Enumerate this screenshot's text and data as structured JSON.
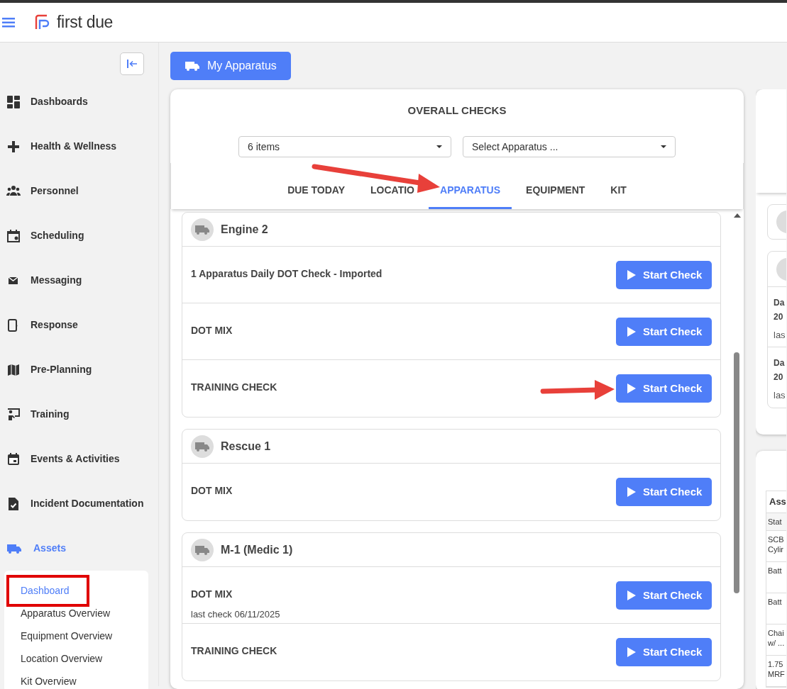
{
  "app": {
    "logo_text": "first due"
  },
  "sidebar": {
    "items": [
      {
        "label": "Dashboards",
        "selected": false
      },
      {
        "label": "Health & Wellness",
        "selected": false
      },
      {
        "label": "Personnel",
        "selected": false
      },
      {
        "label": "Scheduling",
        "selected": false
      },
      {
        "label": "Messaging",
        "selected": false
      },
      {
        "label": "Response",
        "selected": false
      },
      {
        "label": "Pre-Planning",
        "selected": false
      },
      {
        "label": "Training",
        "selected": false
      },
      {
        "label": "Events & Activities",
        "selected": false
      },
      {
        "label": "Incident Documentation",
        "selected": false
      },
      {
        "label": "Assets",
        "selected": true
      }
    ],
    "sub_items": [
      {
        "label": "Dashboard",
        "selected": true,
        "highlighted": true
      },
      {
        "label": "Apparatus Overview",
        "selected": false,
        "highlighted": false
      },
      {
        "label": "Equipment Overview",
        "selected": false,
        "highlighted": false
      },
      {
        "label": "Location Overview",
        "selected": false,
        "highlighted": false
      },
      {
        "label": "Kit Overview",
        "selected": false,
        "highlighted": false
      }
    ]
  },
  "header_button": "My Apparatus",
  "checks": {
    "title": "OVERALL CHECKS",
    "filter": {
      "value": "6 items"
    },
    "apparatus_select": {
      "placeholder": "Select Apparatus ..."
    },
    "tabs": [
      {
        "label": "DUE TODAY",
        "selected": false
      },
      {
        "label": "LOCATIO",
        "selected": false
      },
      {
        "label": "APPARATUS",
        "selected": true
      },
      {
        "label": "EQUIPMENT",
        "selected": false
      },
      {
        "label": "KIT",
        "selected": false
      }
    ],
    "groups": [
      {
        "name": "Engine 2",
        "rows": [
          {
            "title": "1 Apparatus Daily DOT Check - Imported",
            "button": "Start Check"
          },
          {
            "title": "DOT MIX",
            "button": "Start Check"
          },
          {
            "title": "TRAINING CHECK",
            "button": "Start Check"
          }
        ]
      },
      {
        "name": "Rescue 1",
        "rows": [
          {
            "title": "DOT MIX",
            "button": "Start Check"
          }
        ]
      },
      {
        "name": "M-1 (Medic 1)",
        "rows": [
          {
            "title": "DOT MIX",
            "last_check": "last check 06/11/2025",
            "button": "Start Check"
          },
          {
            "title": "TRAINING CHECK",
            "button": "Start Check"
          }
        ]
      }
    ]
  },
  "right_panel": {
    "items": [
      {
        "title_lines": [
          "Da",
          "20"
        ],
        "subtitle": "las"
      },
      {
        "title_lines": [
          "Da",
          "20"
        ],
        "subtitle": "las"
      }
    ],
    "table": {
      "title": "Ass",
      "column_1": "Stat",
      "rows": [
        [
          "SCB",
          "Cylir"
        ],
        [
          "Batt"
        ],
        [
          "Batt"
        ],
        [
          "Chai",
          "w/ ..."
        ],
        [
          "1.75",
          "MRF"
        ]
      ]
    }
  }
}
